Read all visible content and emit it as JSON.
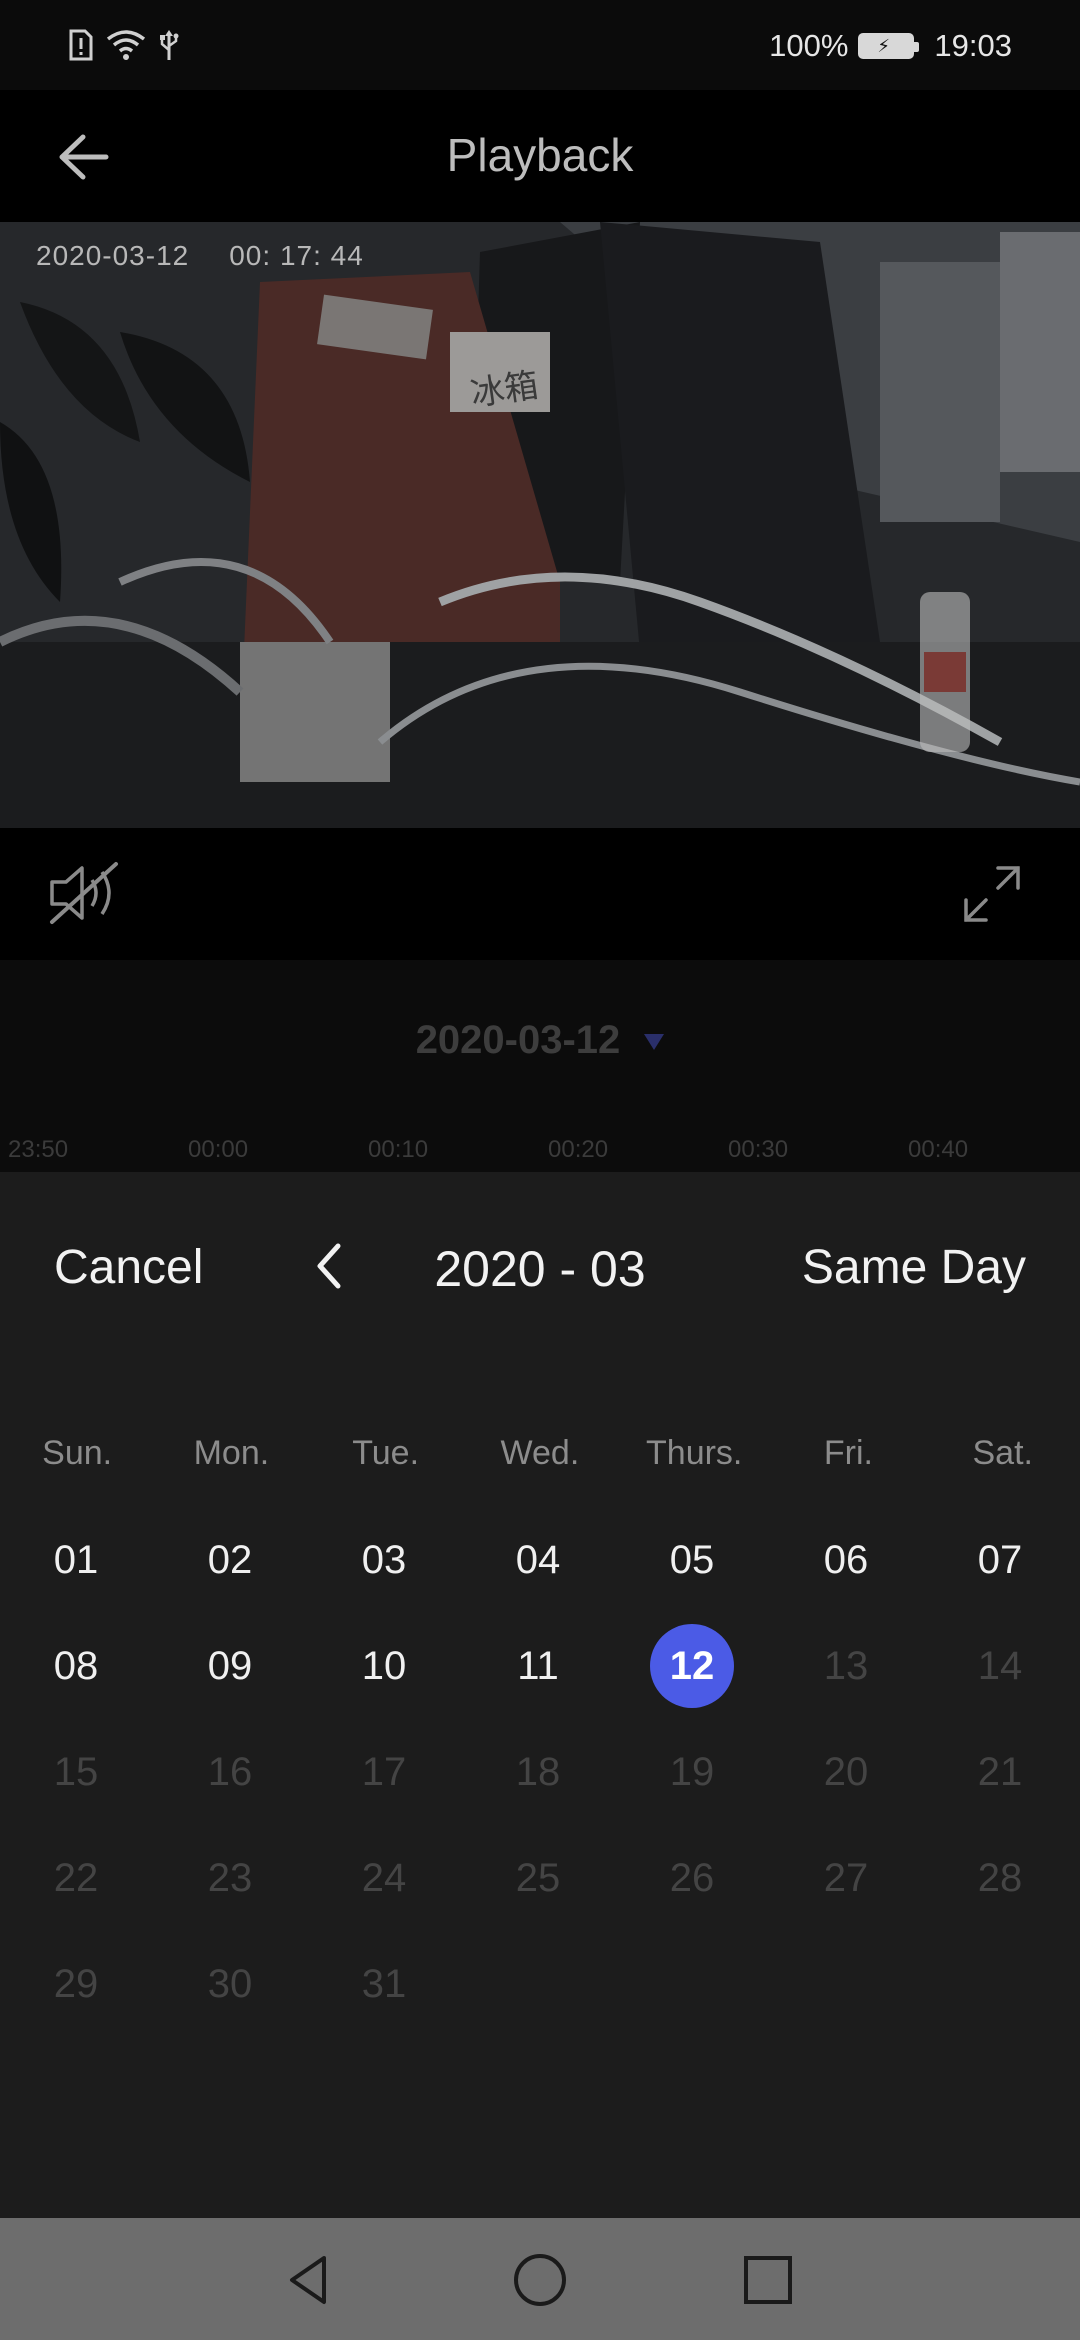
{
  "status_bar": {
    "battery_percent": "100%",
    "time": "19:03",
    "left_icons": [
      "sim-alert-icon",
      "wifi-icon",
      "usb-icon"
    ]
  },
  "header": {
    "title": "Playback"
  },
  "video": {
    "osd_date": "2020-03-12",
    "osd_time": "00: 17: 44",
    "poster_text": "冰箱"
  },
  "date_selector": {
    "date": "2020-03-12"
  },
  "timeline": {
    "ticks": [
      "23:50",
      "00:00",
      "00:10",
      "00:20",
      "00:30",
      "00:40"
    ]
  },
  "calendar": {
    "cancel_label": "Cancel",
    "month_label": "2020 - 03",
    "same_day_label": "Same Day",
    "weekdays": [
      "Sun.",
      "Mon.",
      "Tue.",
      "Wed.",
      "Thurs.",
      "Fri.",
      "Sat."
    ],
    "selected_day": "12",
    "days": [
      [
        "01",
        "02",
        "03",
        "04",
        "05",
        "06",
        "07"
      ],
      [
        "08",
        "09",
        "10",
        "11",
        "12",
        "13",
        "14"
      ],
      [
        "15",
        "16",
        "17",
        "18",
        "19",
        "20",
        "21"
      ],
      [
        "22",
        "23",
        "24",
        "25",
        "26",
        "27",
        "28"
      ],
      [
        "29",
        "30",
        "31"
      ]
    ],
    "enabled_through": 12
  },
  "colors": {
    "accent": "#4b5be6",
    "sheet_bg": "#1c1c1c",
    "disabled_day": "#444444",
    "navbar_bg": "#6d6d6d"
  }
}
